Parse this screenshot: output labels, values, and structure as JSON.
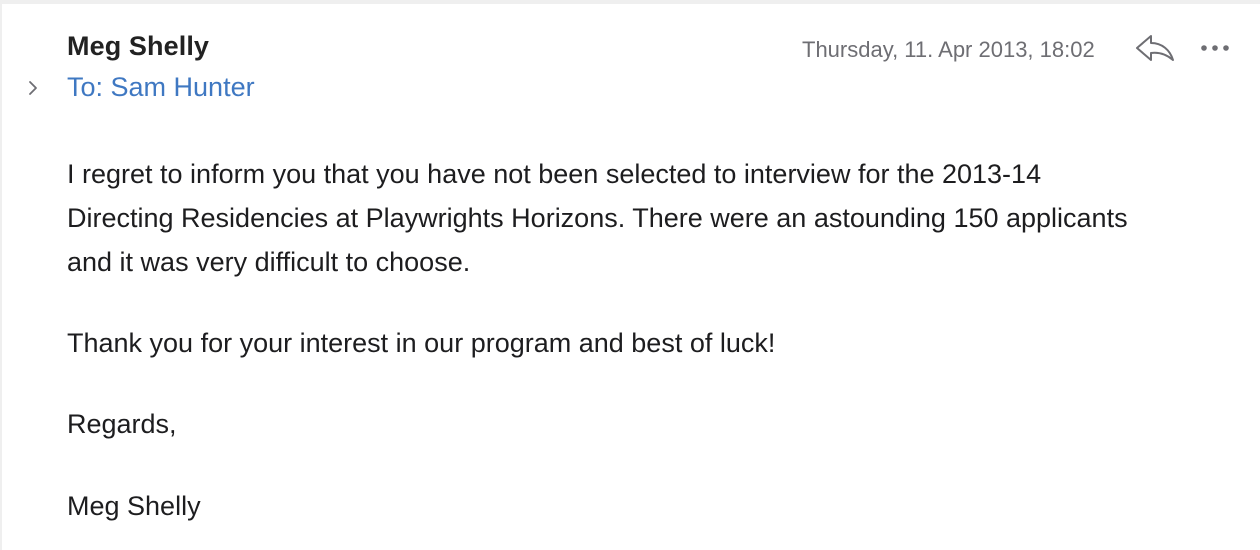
{
  "message": {
    "sender": "Meg Shelly",
    "recipient": "To: Sam Hunter",
    "date": "Thursday, 11. Apr 2013, 18:02",
    "body": [
      "I regret to inform you that you have not been selected to interview for the 2013-14 Directing Residencies at Playwrights Horizons. There were an astounding 150 applicants and it was very difficult to choose.",
      "Thank you for your interest in our program and best of luck!",
      "Regards,",
      "Meg Shelly"
    ]
  },
  "icons": {
    "disclosure": "chevron-right-icon",
    "reply": "reply-icon",
    "more": "ellipsis-icon"
  },
  "colors": {
    "recipient": "#3f78c2",
    "date": "#6e6e73",
    "text": "#1d1d1f",
    "icon": "#6e6e73"
  }
}
